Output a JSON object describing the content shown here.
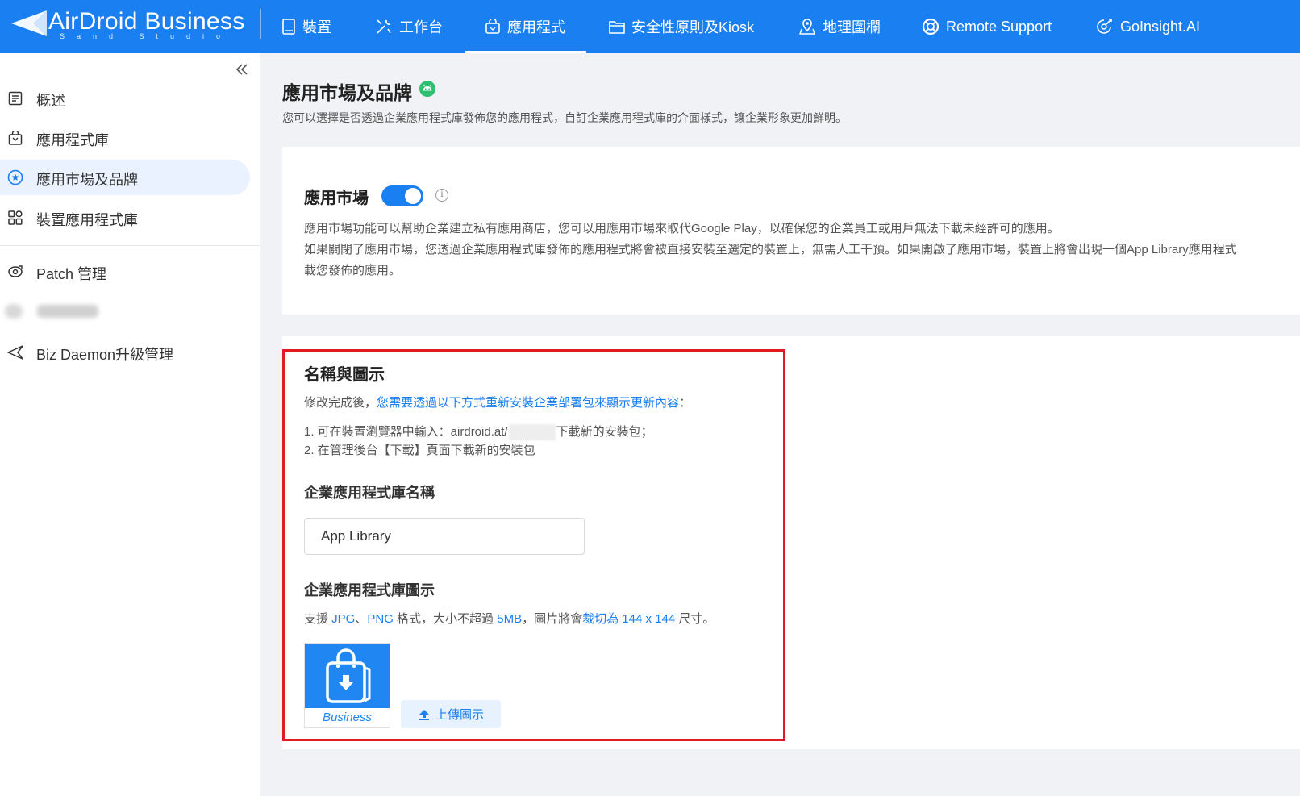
{
  "brand": {
    "name": "AirDroid Business",
    "sub": "Sand Studio"
  },
  "nav": {
    "items": [
      {
        "label": "裝置",
        "icon": "device-icon"
      },
      {
        "label": "工作台",
        "icon": "tools-icon"
      },
      {
        "label": "應用程式",
        "icon": "app-bag-icon",
        "active": true
      },
      {
        "label": "安全性原則及Kiosk",
        "icon": "folder-icon"
      },
      {
        "label": "地理圍欄",
        "icon": "geofence-icon"
      },
      {
        "label": "Remote Support",
        "icon": "lifebuoy-icon"
      },
      {
        "label": "GoInsight.AI",
        "icon": "ai-icon"
      }
    ]
  },
  "sidebar": {
    "items": [
      {
        "label": "概述",
        "icon": "overview-icon"
      },
      {
        "label": "應用程式庫",
        "icon": "app-library-icon"
      },
      {
        "label": "應用市場及品牌",
        "icon": "star-badge-icon",
        "active": true
      },
      {
        "label": "裝置應用程式庫",
        "icon": "grid-apps-icon"
      },
      {
        "label": "Patch 管理",
        "icon": "patch-icon"
      },
      {
        "label": "Biz Daemon升級管理",
        "icon": "send-icon"
      }
    ]
  },
  "page": {
    "title": "應用市場及品牌",
    "description": "您可以選擇是否透過企業應用程式庫發佈您的應用程式，自訂企業應用程式庫的介面樣式，讓企業形象更加鮮明。"
  },
  "market": {
    "title": "應用市場",
    "enabled": true,
    "lines": [
      "應用市場功能可以幫助企業建立私有應用商店，您可以用應用市場來取代Google Play，以確保您的企業員工或用戶無法下載未經許可的應用。",
      "如果關閉了應用市場，您透過企業應用程式庫發佈的應用程式將會被直接安裝至選定的裝置上，無需人工干預。如果開啟了應用市場，裝置上將會出現一個App Library應用程式",
      "載您發佈的應用。"
    ]
  },
  "branding": {
    "title": "名稱與圖示",
    "hint_prefix": "修改完成後，",
    "hint_link": "您需要透過以下方式重新安裝企業部署包來顯示更新內容",
    "hint_suffix": "：",
    "step1_prefix": "1. 可在裝置瀏覽器中輸入：airdroid.at/",
    "step1_suffix": "下載新的安裝包；",
    "step2": "2. 在管理後台【下載】頁面下載新的安裝包",
    "name_label": "企業應用程式庫名稱",
    "name_value": "App Library",
    "icon_label": "企業應用程式庫圖示",
    "fmt": {
      "t1": "支援 ",
      "jpg": "JPG",
      "sep": "、",
      "png": "PNG",
      "t2": " 格式，大小不超過 ",
      "size": "5MB",
      "t3": "，圖片將會",
      "crop": "裁切為 144 x 144",
      "t4": " 尺寸。"
    },
    "icon_caption": "Business",
    "upload_label": "上傳圖示"
  },
  "colors": {
    "primary": "#1a7ff0",
    "highlight": "#e21b23",
    "android": "#3ddc84"
  }
}
